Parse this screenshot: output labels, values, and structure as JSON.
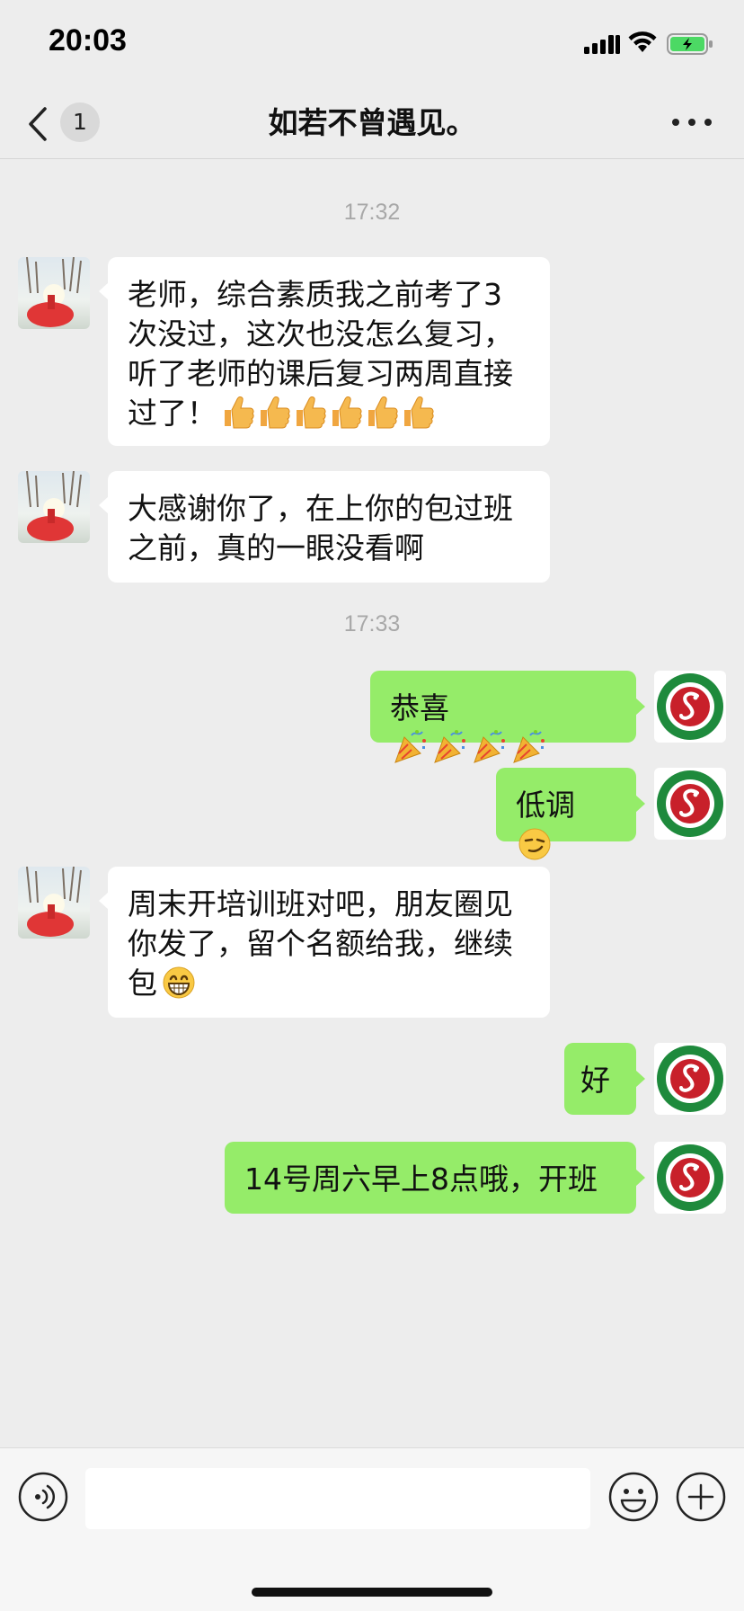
{
  "status_bar": {
    "time": "20:03"
  },
  "nav": {
    "unread_count": "1",
    "title": "如若不曾遇见。"
  },
  "timestamps": [
    "17:32",
    "17:33"
  ],
  "messages": [
    {
      "direction": "in",
      "text": "老师，综合素质我之前考了3次没过，这次也没怎么复习，听了老师的课后复习两周直接过了！",
      "emoji": "thumbs-up",
      "emoji_count": 6
    },
    {
      "direction": "in",
      "text": "大感谢你了，在上你的包过班之前，真的一眼没看啊"
    },
    {
      "direction": "out",
      "text": "恭喜",
      "emoji": "party-popper",
      "emoji_count": 4
    },
    {
      "direction": "out",
      "text": "低调",
      "emoji": "smirk-face",
      "emoji_count": 1
    },
    {
      "direction": "in",
      "text": "周末开培训班对吧，朋友圈见你发了，留个名额给我，继续包",
      "emoji": "grin-face",
      "emoji_count": 1
    },
    {
      "direction": "out",
      "text": "好"
    },
    {
      "direction": "out",
      "text": "14号周六早上8点哦，开班"
    }
  ],
  "colors": {
    "background": "#ededed",
    "incoming_bubble": "#ffffff",
    "outgoing_bubble": "#95ec69",
    "badge": "#d9d9d9",
    "logo_red": "#c8202a",
    "logo_green": "#1e8a3c"
  },
  "input": {
    "value": ""
  }
}
